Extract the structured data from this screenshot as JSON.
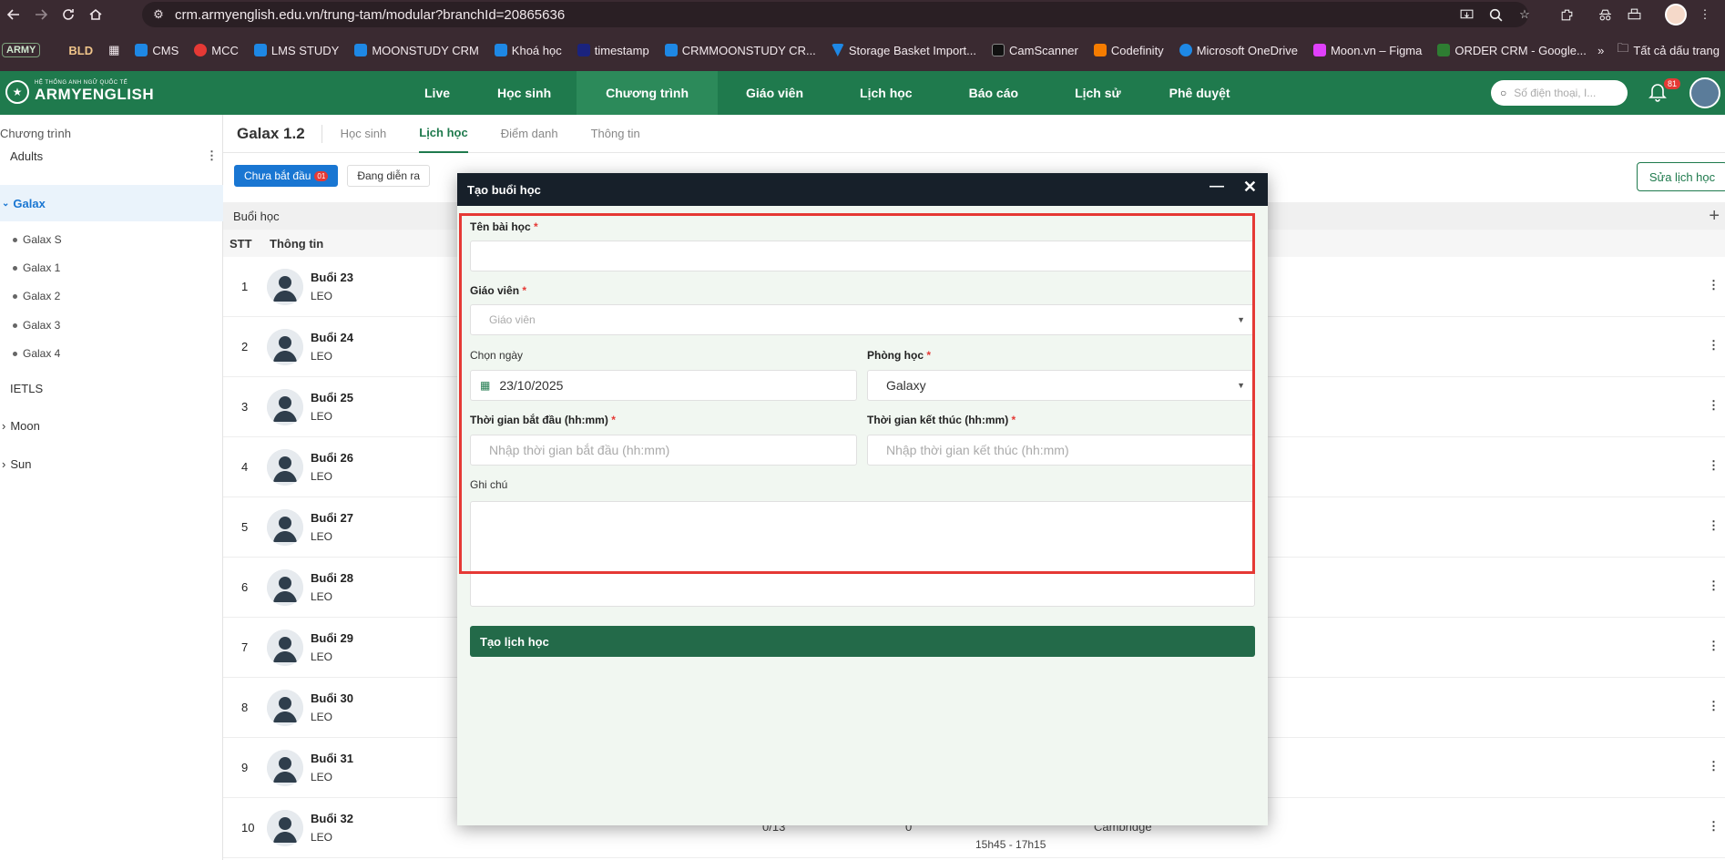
{
  "browser": {
    "url": "crm.armyenglish.edu.vn/trung-tam/modular?branchId=20865636",
    "bookmarks": [
      {
        "label": "ARMY",
        "color": "#7ea27e"
      },
      {
        "label": "BLD",
        "color": "#d79a44"
      },
      {
        "label": "CMS",
        "color": "#1e88e5"
      },
      {
        "label": "MCC",
        "color": "#e53935"
      },
      {
        "label": "LMS STUDY",
        "color": "#1e88e5"
      },
      {
        "label": "MOONSTUDY CRM",
        "color": "#1e88e5"
      },
      {
        "label": "Khoá học",
        "color": "#1e88e5"
      },
      {
        "label": "timestamp",
        "color": "#1a237e"
      },
      {
        "label": "CRMMOONSTUDY CR...",
        "color": "#1e88e5"
      },
      {
        "label": "Storage Basket Import...",
        "color": "#1e88e5"
      },
      {
        "label": "CamScanner",
        "color": "#111111"
      },
      {
        "label": "Codefinity",
        "color": "#f57c00"
      },
      {
        "label": "Microsoft OneDrive",
        "color": "#1e88e5"
      },
      {
        "label": "Moon.vn – Figma",
        "color": "#e040fb"
      },
      {
        "label": "ORDER CRM - Google...",
        "color": "#2e7d32"
      }
    ],
    "bookmarks_more": "Tất cả dấu trang"
  },
  "header": {
    "logo_small": "HỆ THỐNG ANH NGỮ QUỐC TẾ",
    "logo_big": "ARMYENGLISH",
    "menu": [
      "Live",
      "Học sinh",
      "Chương trình",
      "Giáo viên",
      "Lịch học",
      "Báo cáo",
      "Lịch sử",
      "Phê duyệt"
    ],
    "active_menu": "Chương trình",
    "search_placeholder": "Số điện thoại, I...",
    "notifications": "81"
  },
  "sidebar": {
    "title": "Chương trình",
    "items": [
      {
        "label": "Adults"
      },
      {
        "label": "Galax"
      },
      {
        "label": "Galax S"
      },
      {
        "label": "Galax 1"
      },
      {
        "label": "Galax 2"
      },
      {
        "label": "Galax 3"
      },
      {
        "label": "Galax 4"
      },
      {
        "label": "IETLS"
      },
      {
        "label": "Moon"
      },
      {
        "label": "Sun"
      }
    ]
  },
  "main": {
    "class_name": "Galax 1.2",
    "tabs": [
      "Học sinh",
      "Lịch học",
      "Điểm danh",
      "Thông tin"
    ],
    "active_tab": "Lịch học",
    "filters": [
      {
        "label": "Chưa bắt đầu",
        "count": "01"
      },
      {
        "label": "Đang diễn ra"
      }
    ],
    "edit_button": "Sửa lịch học",
    "section_title": "Buổi học",
    "columns": [
      "STT",
      "Thông tin"
    ],
    "rows": [
      {
        "stt": "1",
        "title": "Buổi 23",
        "teacher": "LEO"
      },
      {
        "stt": "2",
        "title": "Buổi 24",
        "teacher": "LEO"
      },
      {
        "stt": "3",
        "title": "Buổi 25",
        "teacher": "LEO"
      },
      {
        "stt": "4",
        "title": "Buổi 26",
        "teacher": "LEO"
      },
      {
        "stt": "5",
        "title": "Buổi 27",
        "teacher": "LEO"
      },
      {
        "stt": "6",
        "title": "Buổi 28",
        "teacher": "LEO"
      },
      {
        "stt": "7",
        "title": "Buổi 29",
        "teacher": "LEO"
      },
      {
        "stt": "8",
        "title": "Buổi 30",
        "teacher": "LEO"
      },
      {
        "stt": "9",
        "title": "Buổi 31",
        "teacher": "LEO"
      },
      {
        "stt": "10",
        "title": "Buổi 32",
        "teacher": "LEO",
        "attendance": "0/13",
        "count": "0",
        "time": "15h45 - 17h15",
        "room": "Cambridge"
      }
    ]
  },
  "modal": {
    "title": "Tạo buổi học",
    "lesson_name_label": "Tên bài học",
    "lesson_name_value": "",
    "teacher_label": "Giáo viên",
    "teacher_placeholder": "Giáo viên",
    "date_label": "Chọn ngày",
    "date_value": "23/10/2025",
    "room_label": "Phòng học",
    "room_value": "Galaxy",
    "start_label": "Thời gian bắt đầu (hh:mm)",
    "start_placeholder": "Nhập thời gian bắt đầu (hh:mm)",
    "end_label": "Thời gian kết thúc (hh:mm)",
    "end_placeholder": "Nhập thời gian kết thúc (hh:mm)",
    "note_label": "Ghi chú",
    "submit_label": "Tạo lịch học",
    "required_mark": "*"
  }
}
